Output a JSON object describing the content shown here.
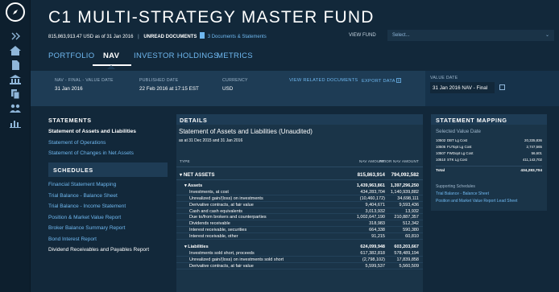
{
  "header": {
    "title": "C1 MULTI-STRATEGY MASTER FUND",
    "amount": "815,863,913.47 USD",
    "as_of": "as of 31 Jan 2016",
    "separator": "|",
    "unread_label": "UNREAD DOCUMENTS",
    "unread_link": "3 Documents & Statements",
    "view_fund_label": "VIEW FUND",
    "view_fund_placeholder": "Select...",
    "view_fund_chevron": "⌄"
  },
  "tabs": [
    {
      "label": "PORTFOLIO",
      "active": false
    },
    {
      "label": "NAV",
      "active": true
    },
    {
      "label": "INVESTOR HOLDINGS",
      "active": false
    },
    {
      "label": "METRICS",
      "active": false
    }
  ],
  "infobar": {
    "nav_label": "NAV - FINAL - VALUE DATE",
    "nav_value": "31 Jan 2016",
    "published_label": "PUBLISHED DATE",
    "published_value": "22 Feb 2016 at 17:15 EST",
    "currency_label": "CURRENCY",
    "currency_value": "USD",
    "related_docs": "VIEW RELATED DOCUMENTS",
    "export_data": "EXPORT DATA",
    "value_date_label": "VALUE DATE",
    "value_date_value": "31 Jan 2016 NAV - Final"
  },
  "statements": {
    "heading": "STATEMENTS",
    "items": [
      {
        "label": "Statement of Assets and Liabilities",
        "active": true
      },
      {
        "label": "Statement of Operations",
        "active": false
      },
      {
        "label": "Statement of Changes in Net Assets",
        "active": false
      }
    ]
  },
  "schedules": {
    "heading": "SCHEDULES",
    "items": [
      {
        "label": "Financial Statement Mapping",
        "white": false
      },
      {
        "label": "Trial Balance - Balance Sheet",
        "white": false
      },
      {
        "label": "Trial Balance - Income Statement",
        "white": false
      },
      {
        "label": "Position & Market Value Report",
        "white": false
      },
      {
        "label": "Broker Balance Summary Report",
        "white": false
      },
      {
        "label": "Bond Interest Report",
        "white": false
      },
      {
        "label": "Dividend Receivables and Payables Report",
        "white": true
      }
    ]
  },
  "details": {
    "heading": "DETAILS",
    "title": "Statement of Assets and Liabilities (Unaudited)",
    "subtitle": "as at 31 Dec 2015 and 31 Jan 2016",
    "col_type": "TYPE",
    "col_nav": "NAV AMOUNT",
    "col_prior": "PRIOR NAV AMOUNT",
    "rows": [
      {
        "label": "▾ NET ASSETS",
        "nav": "815,863,914",
        "prior": "794,092,582",
        "level": 0
      },
      {
        "label": "▾ Assets",
        "nav": "1,439,963,861",
        "prior": "1,397,296,250",
        "level": 1
      },
      {
        "label": "Investments, at cost",
        "nav": "434,283,704",
        "prior": "1,140,939,882",
        "level": 2
      },
      {
        "label": "Unrealized gain/(loss) on investments",
        "nav": "(10,460,172)",
        "prior": "34,698,111",
        "level": 2
      },
      {
        "label": "Derivative contracts, at fair value",
        "nav": "9,404,671",
        "prior": "9,593,436",
        "level": 2
      },
      {
        "label": "Cash and cash equivalents",
        "nav": "3,013,932",
        "prior": "13,932",
        "level": 2
      },
      {
        "label": "Due to/from brokers and counterparties",
        "nav": "1,002,647,190",
        "prior": "210,887,357",
        "level": 2
      },
      {
        "label": "Dividends receivable",
        "nav": "318,983",
        "prior": "512,342",
        "level": 2
      },
      {
        "label": "Interest receivable, securities",
        "nav": "664,338",
        "prior": "590,380",
        "level": 2
      },
      {
        "label": "Interest receivable, other",
        "nav": "91,215",
        "prior": "60,810",
        "level": 2
      },
      {
        "label": "▾ Liabilities",
        "nav": "624,099,948",
        "prior": "603,203,667",
        "level": 1,
        "gap": true
      },
      {
        "label": "Investments sold short, proceeds",
        "nav": "617,382,818",
        "prior": "578,489,194",
        "level": 2
      },
      {
        "label": "Unrealized gain/(loss) on investments sold short",
        "nav": "(2,798,102)",
        "prior": "17,839,858",
        "level": 2
      },
      {
        "label": "Derivative contracts, at fair value",
        "nav": "5,599,537",
        "prior": "5,560,509",
        "level": 2
      }
    ]
  },
  "mapping": {
    "heading": "STATEMENT MAPPING",
    "selected_label": "Selected Value Date",
    "rows": [
      {
        "code": "10502",
        "name": "DBT Lg Cost",
        "value": "20,335,836"
      },
      {
        "code": "10505",
        "name": "FUTopt Lg Cost",
        "value": "2,747,565"
      },
      {
        "code": "10507",
        "name": "FWDopt Lg Cost",
        "value": "56,601"
      },
      {
        "code": "10510",
        "name": "STK Lg Cost",
        "value": "411,143,702"
      }
    ],
    "total_label": "Total",
    "total_value": "434,283,704",
    "supporting_label": "Supporting Schedules",
    "links": [
      "Trial Balance - Balance Sheet",
      "Position and Market Value Report Lead Sheet"
    ]
  },
  "icons": {
    "logo": "compass-icon",
    "rail": [
      "expand-icon",
      "home-icon",
      "document-icon",
      "bank-icon",
      "files-icon",
      "users-icon",
      "chart-icon"
    ]
  },
  "colors": {
    "background": "#12283a",
    "panel": "#1e3c55",
    "link": "#6fb8f0"
  }
}
